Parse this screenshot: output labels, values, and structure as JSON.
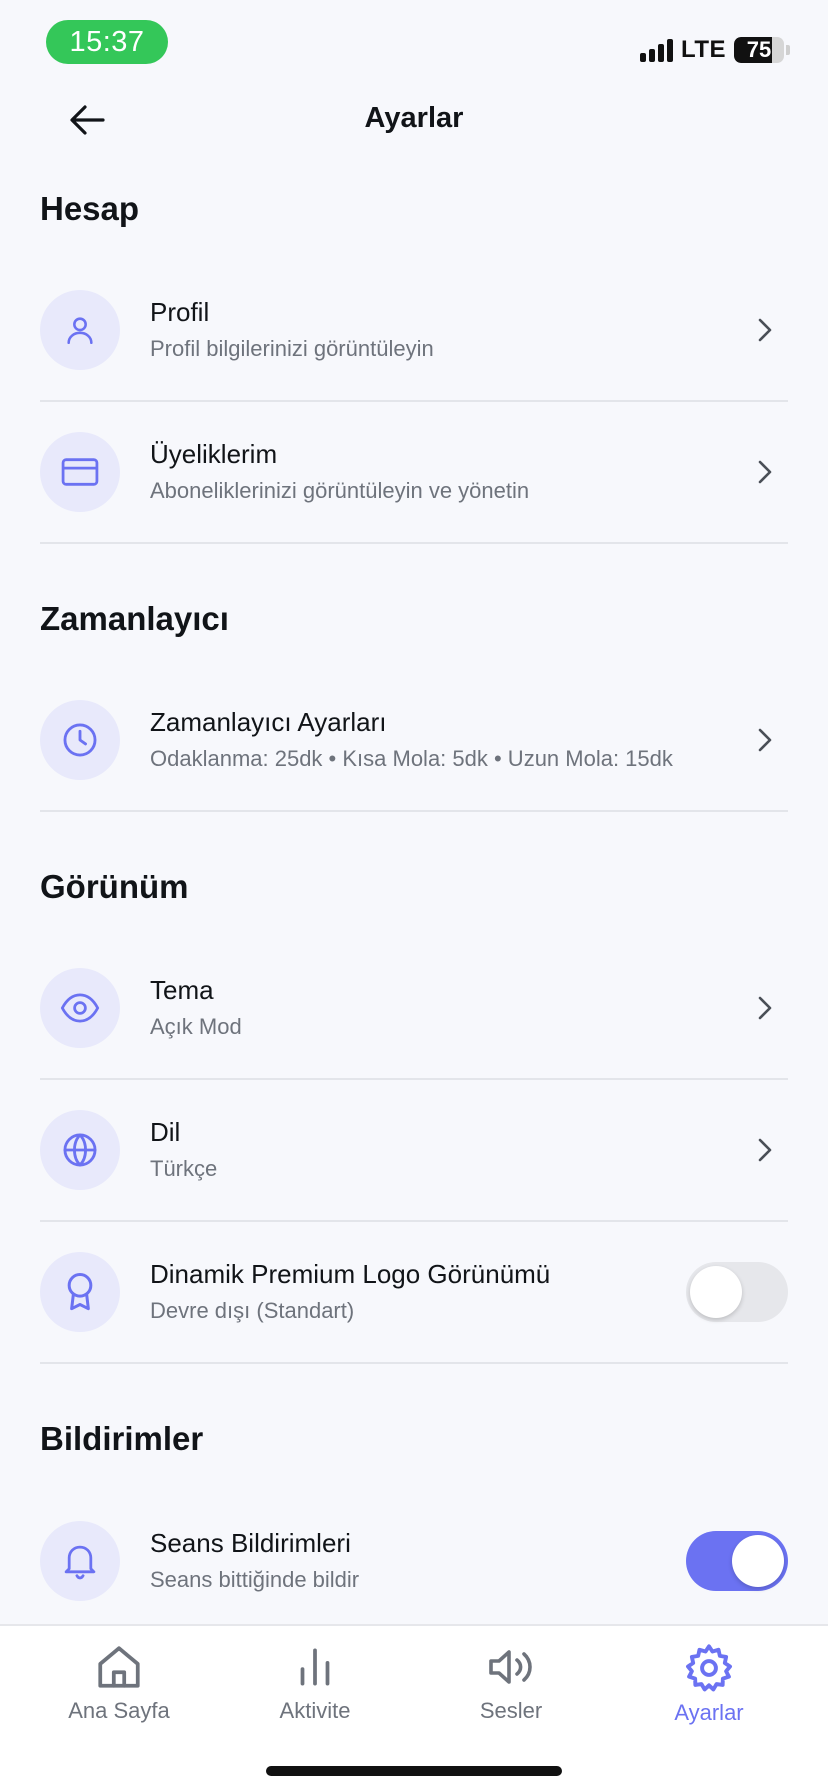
{
  "status_bar": {
    "time": "15:37",
    "network": "LTE",
    "battery": "75",
    "battery_level": 0.75
  },
  "header": {
    "title": "Ayarlar",
    "back_icon": "arrow-left-icon"
  },
  "sections": {
    "account": {
      "title": "Hesap",
      "items": [
        {
          "title": "Profil",
          "subtitle": "Profil bilgilerinizi görüntüleyin",
          "icon": "user-icon"
        },
        {
          "title": "Üyeliklerim",
          "subtitle": "Aboneliklerinizi görüntüleyin ve yönetin",
          "icon": "credit-card-icon"
        }
      ]
    },
    "timer": {
      "title": "Zamanlayıcı",
      "items": [
        {
          "title": "Zamanlayıcı Ayarları",
          "subtitle": "Odaklanma: 25dk • Kısa Mola: 5dk • Uzun Mola: 15dk",
          "icon": "clock-icon"
        }
      ]
    },
    "appearance": {
      "title": "Görünüm",
      "items": [
        {
          "title": "Tema",
          "subtitle": "Açık Mod",
          "icon": "eye-icon"
        },
        {
          "title": "Dil",
          "subtitle": "Türkçe",
          "icon": "globe-icon"
        },
        {
          "title": "Dinamik Premium Logo Görünümü",
          "subtitle": "Devre dışı (Standart)",
          "icon": "award-icon",
          "toggle": false
        }
      ]
    },
    "notifications": {
      "title": "Bildirimler",
      "items": [
        {
          "title": "Seans Bildirimleri",
          "subtitle": "Seans bittiğinde bildir",
          "icon": "bell-icon",
          "toggle": true
        }
      ]
    }
  },
  "tab_bar": {
    "tabs": [
      {
        "label": "Ana Sayfa",
        "icon": "home-icon"
      },
      {
        "label": "Aktivite",
        "icon": "bar-chart-icon"
      },
      {
        "label": "Sesler",
        "icon": "speaker-icon"
      },
      {
        "label": "Ayarlar",
        "icon": "gear-icon",
        "active": true
      }
    ]
  },
  "colors": {
    "accent": "#6b72f2",
    "icon_bg": "#e8e9fb",
    "status_green": "#34c759",
    "background": "#f7f8fc"
  }
}
